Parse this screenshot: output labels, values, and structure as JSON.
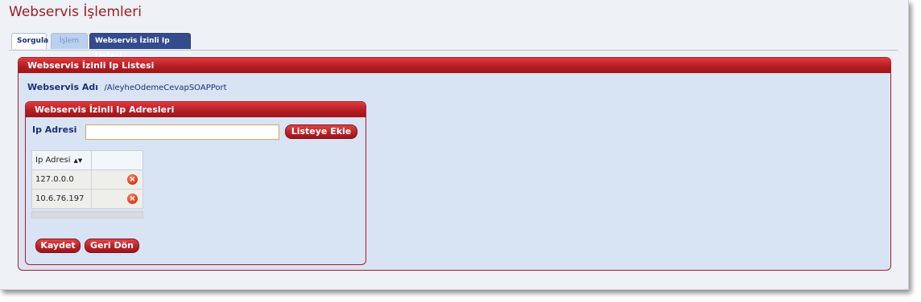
{
  "page": {
    "title": "Webservis İşlemleri"
  },
  "tabs": [
    {
      "label": "Sorgula",
      "state": "normal"
    },
    {
      "label": "İşlem",
      "state": "disabled"
    },
    {
      "label": "Webservis İzinli Ip Listesi",
      "state": "active"
    }
  ],
  "outer_panel": {
    "header": "Webservis İzinli Ip Listesi",
    "service_label": "Webservis Adı",
    "service_value": "/AleyheOdemeCevapSOAPPort"
  },
  "inner_panel": {
    "header": "Webservis İzinli Ip Adresleri",
    "ip_label": "Ip Adresi",
    "ip_input_value": "",
    "add_button": "Listeye Ekle"
  },
  "table": {
    "columns": [
      "Ip Adresi",
      ""
    ],
    "rows": [
      {
        "ip": "127.0.0.0",
        "action_icon": "delete-icon"
      },
      {
        "ip": "10.6.76.197",
        "action_icon": "delete-icon"
      }
    ]
  },
  "buttons": {
    "save": "Kaydet",
    "back": "Geri Dön"
  },
  "colors": {
    "title": "#9b1e22",
    "panel_header": "#b01c22",
    "panel_bg": "#d8e3f3",
    "active_tab": "#344b8c"
  }
}
